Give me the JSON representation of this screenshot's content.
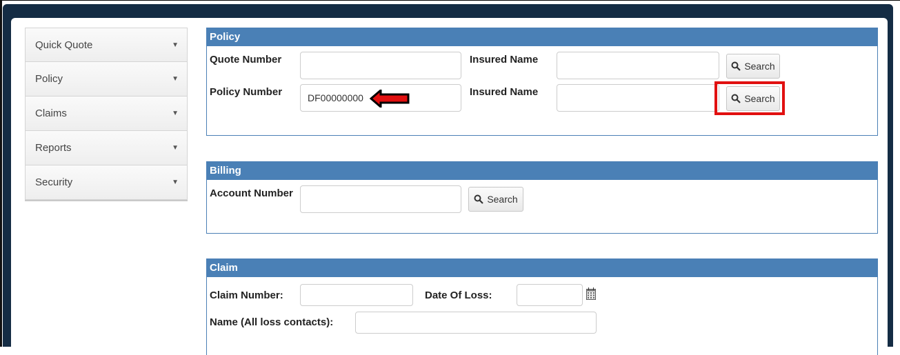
{
  "sidebar": {
    "items": [
      {
        "label": "Quick Quote",
        "caret": "▼"
      },
      {
        "label": "Policy",
        "caret": "▼"
      },
      {
        "label": "Claims",
        "caret": "▼"
      },
      {
        "label": "Reports",
        "caret": "▼"
      },
      {
        "label": "Security",
        "caret": "▼"
      }
    ]
  },
  "policy": {
    "title": "Policy",
    "quote_number_label": "Quote Number",
    "quote_number_value": "",
    "insured_name_label_1": "Insured Name",
    "insured_name_value_1": "",
    "search_label_1": "Search",
    "policy_number_label": "Policy Number",
    "policy_number_value": "DF00000000",
    "insured_name_label_2": "Insured Name",
    "insured_name_value_2": "",
    "search_label_2": "Search"
  },
  "billing": {
    "title": "Billing",
    "account_number_label": "Account Number",
    "account_number_value": "",
    "search_label": "Search"
  },
  "claim": {
    "title": "Claim",
    "claim_number_label": "Claim Number:",
    "claim_number_value": "",
    "date_of_loss_label": "Date Of Loss:",
    "date_of_loss_value": "",
    "name_label": "Name (All loss contacts):",
    "name_value": ""
  },
  "icons": {
    "search": "search-icon",
    "calendar": "calendar-icon",
    "caret": "caret-down-icon",
    "annotation_arrow": "left-arrow-icon"
  },
  "colors": {
    "panel_header": "#4a80b6",
    "frame": "#142c44",
    "highlight": "#e11010"
  }
}
